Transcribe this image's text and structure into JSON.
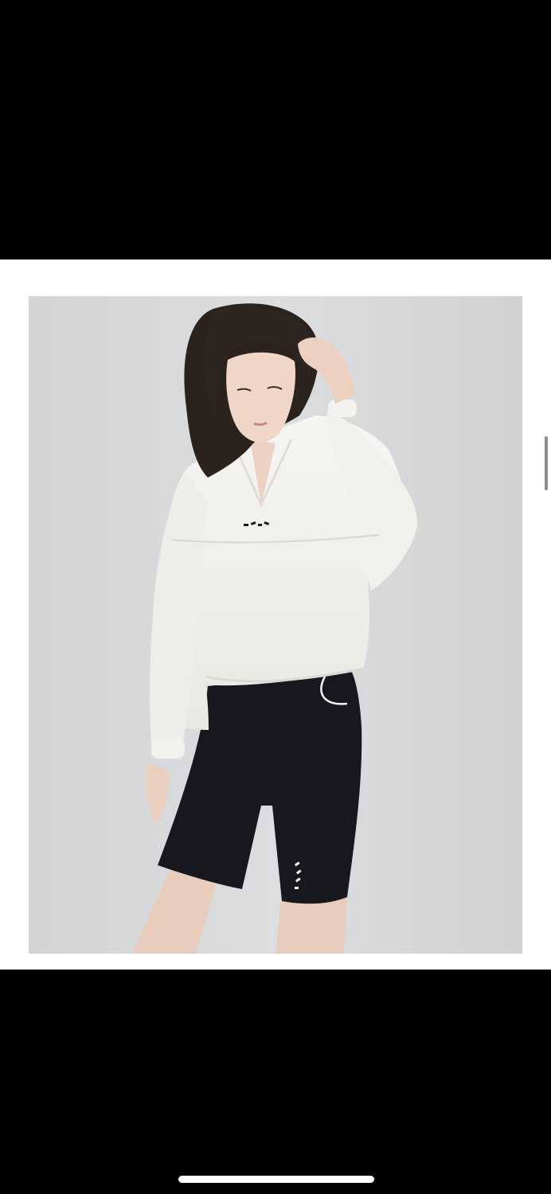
{
  "colors": {
    "background": "#000000",
    "card": "#ffffff",
    "photo_backdrop": "#d9dadc",
    "shirt": "#f4f3ef",
    "shorts": "#15161b",
    "hair": "#2a211d",
    "skin": "#eed4c4",
    "home_indicator": "#ffffff",
    "scroll_indicator": "#8e8e8e"
  },
  "photo": {
    "subject_icon": "model-photo-icon",
    "logo_marks": [
      "shirt-logo-icon",
      "shorts-logo-icon"
    ]
  },
  "system": {
    "home_indicator_icon": "home-indicator-icon",
    "scroll_indicator_icon": "scroll-indicator-icon"
  }
}
